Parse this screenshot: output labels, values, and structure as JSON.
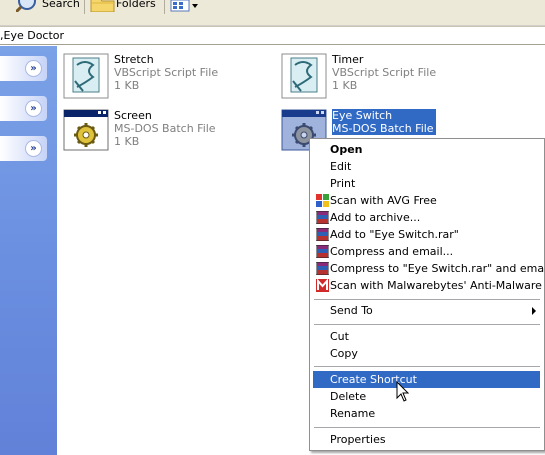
{
  "toolbar": {
    "search_label": "Search",
    "folders_label": "Folders"
  },
  "address": {
    "path": ",Eye Doctor"
  },
  "files": [
    {
      "name": "Stretch",
      "type": "VBScript Script File",
      "size": "1 KB",
      "icon": "vbscript-file-icon"
    },
    {
      "name": "Timer",
      "type": "VBScript Script File",
      "size": "1 KB",
      "icon": "vbscript-file-icon"
    },
    {
      "name": "Screen",
      "type": "MS-DOS Batch File",
      "size": "1 KB",
      "icon": "batch-file-icon"
    },
    {
      "name": "Eye Switch",
      "type": "MS-DOS Batch File",
      "icon": "batch-file-icon"
    }
  ],
  "context_menu": {
    "open": "Open",
    "edit": "Edit",
    "print": "Print",
    "scan_avg": "Scan with AVG Free",
    "add_archive": "Add to archive...",
    "add_rar": "Add to \"Eye Switch.rar\"",
    "compress_email": "Compress and email...",
    "compress_rar_email": "Compress to \"Eye Switch.rar\" and email",
    "scan_malwarebytes": "Scan with Malwarebytes' Anti-Malware",
    "send_to": "Send To",
    "cut": "Cut",
    "copy": "Copy",
    "create_shortcut": "Create Shortcut",
    "delete": "Delete",
    "rename": "Rename",
    "properties": "Properties"
  },
  "colors": {
    "selection": "#316ac5",
    "task_pane": "#6a8ee0"
  }
}
